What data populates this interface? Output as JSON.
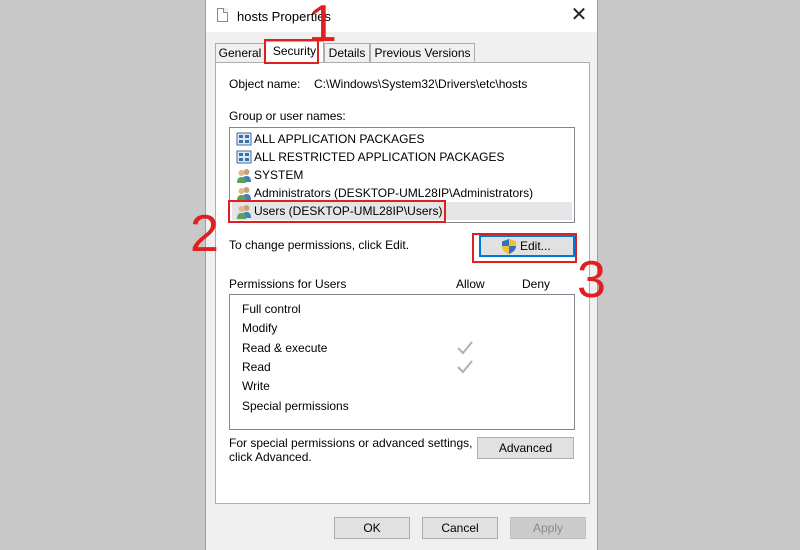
{
  "window": {
    "title": "hosts Properties",
    "close_glyph": "✕"
  },
  "tabs": [
    {
      "label": "General"
    },
    {
      "label": "Security",
      "active": true
    },
    {
      "label": "Details"
    },
    {
      "label": "Previous Versions"
    }
  ],
  "object": {
    "label": "Object name:",
    "value": "C:\\Windows\\System32\\Drivers\\etc\\hosts"
  },
  "groups": {
    "label": "Group or user names:",
    "items": [
      {
        "name": "ALL APPLICATION PACKAGES",
        "icon": "package-icon"
      },
      {
        "name": "ALL RESTRICTED APPLICATION PACKAGES",
        "icon": "package-icon"
      },
      {
        "name": "SYSTEM",
        "icon": "users-icon"
      },
      {
        "name": "Administrators (DESKTOP-UML28IP\\Administrators)",
        "icon": "users-icon"
      },
      {
        "name": "Users (DESKTOP-UML28IP\\Users)",
        "icon": "users-icon",
        "selected": true
      }
    ]
  },
  "change_hint": "To change permissions, click Edit.",
  "edit_button": {
    "label": "Edit...",
    "icon": "uac-shield-icon"
  },
  "permissions": {
    "title": "Permissions for Users",
    "allow_header": "Allow",
    "deny_header": "Deny",
    "rows": [
      {
        "name": "Full control",
        "allow": false,
        "deny": false
      },
      {
        "name": "Modify",
        "allow": false,
        "deny": false
      },
      {
        "name": "Read & execute",
        "allow": true,
        "deny": false
      },
      {
        "name": "Read",
        "allow": true,
        "deny": false
      },
      {
        "name": "Write",
        "allow": false,
        "deny": false
      },
      {
        "name": "Special permissions",
        "allow": false,
        "deny": false
      }
    ]
  },
  "advanced": {
    "hint_line1": "For special permissions or advanced settings,",
    "hint_line2": "click Advanced.",
    "button_label": "Advanced"
  },
  "footer": {
    "ok": "OK",
    "cancel": "Cancel",
    "apply": "Apply"
  },
  "annotations": {
    "step1": "1",
    "step2": "2",
    "step3": "3",
    "color": "#e02020"
  }
}
